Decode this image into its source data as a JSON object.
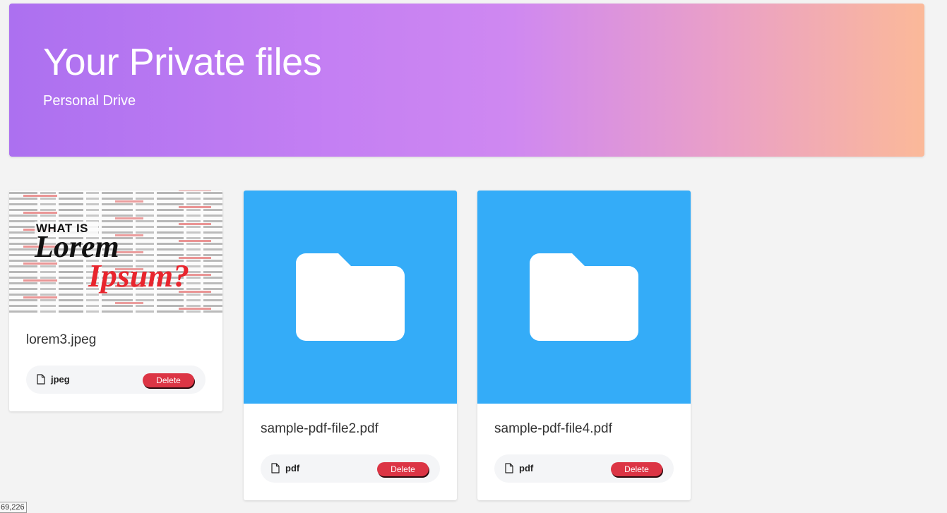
{
  "header": {
    "title": "Your Private files",
    "subtitle": "Personal Drive"
  },
  "files": [
    {
      "name": "lorem3.jpeg",
      "type": "jpeg",
      "thumbnail": "image-preview",
      "thumbnail_text": {
        "line1": "WHAT IS",
        "line2": "Lorem",
        "line3": "Ipsum?"
      },
      "delete_label": "Delete"
    },
    {
      "name": "sample-pdf-file2.pdf",
      "type": "pdf",
      "thumbnail": "folder-icon",
      "delete_label": "Delete"
    },
    {
      "name": "sample-pdf-file4.pdf",
      "type": "pdf",
      "thumbnail": "folder-icon",
      "delete_label": "Delete"
    }
  ],
  "status": {
    "coordinates": "69,226"
  },
  "colors": {
    "hero_start": "#ac70f0",
    "hero_end": "#fbb999",
    "folder_bg": "#34acf8",
    "delete": "#dc3545",
    "page_bg": "#f3f3f3"
  }
}
